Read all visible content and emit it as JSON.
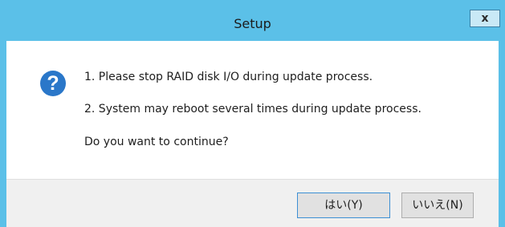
{
  "window": {
    "title": "Setup",
    "close_label": "x"
  },
  "message": {
    "icon": "question-icon",
    "icon_glyph": "?",
    "line1": "1. Please stop RAID disk I/O during update process.",
    "line2": "2. System may reboot several times during update process.",
    "line3": "Do you want to continue?"
  },
  "buttons": {
    "yes_label": "はい(Y)",
    "no_label": "いいえ(N)"
  },
  "colors": {
    "titlebar": "#5bc0e8",
    "icon": "#2a77c9"
  }
}
